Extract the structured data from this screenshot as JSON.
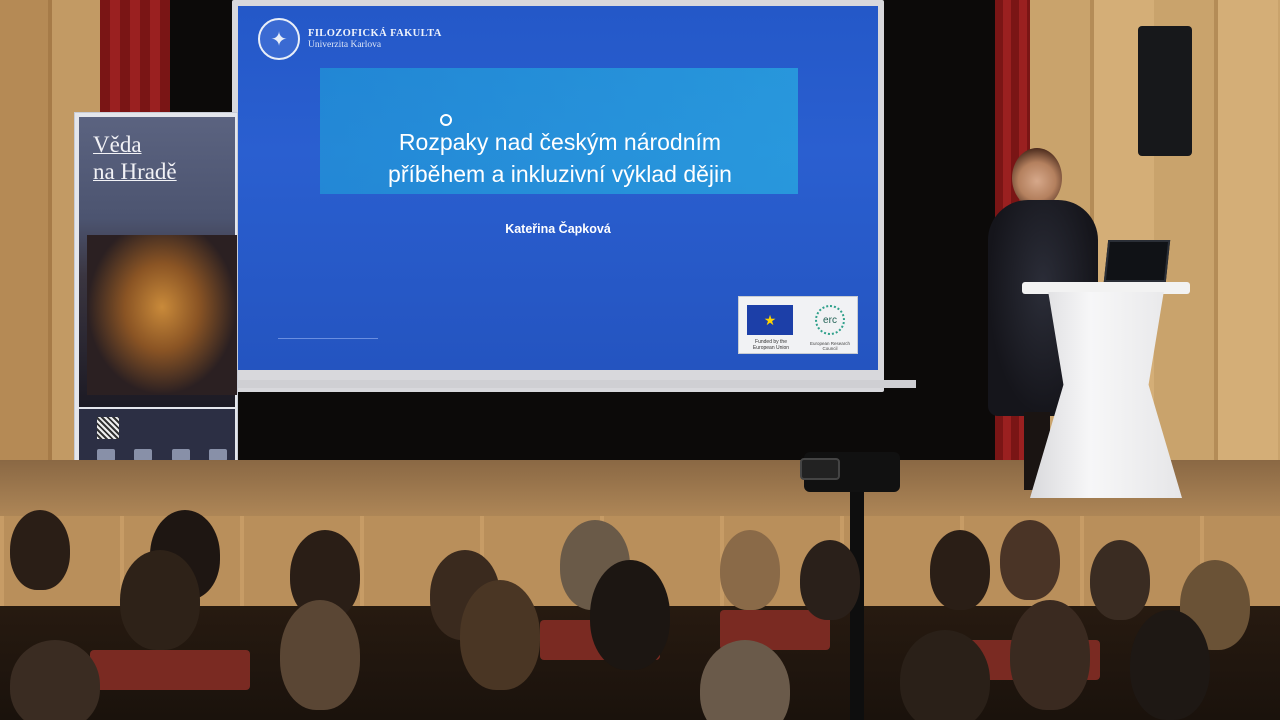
{
  "slide": {
    "university_name": "FILOZOFICKÁ FAKULTA",
    "university_sub": "Univerzita Karlova",
    "title_line1": "Rozpaky nad českým národním",
    "title_line2": "příběhem a inkluzivní výklad dějin",
    "author": "Kateřina Čapková",
    "eu_text": "Funded by the European Union",
    "erc_label": "erc",
    "erc_text": "European Research Council"
  },
  "banner": {
    "title_line1": "Věda",
    "title_line2": "na Hradě"
  },
  "colors": {
    "slide_blue": "#2a5fd0",
    "curtain_red": "#9a2020",
    "wood": "#c29a64"
  }
}
